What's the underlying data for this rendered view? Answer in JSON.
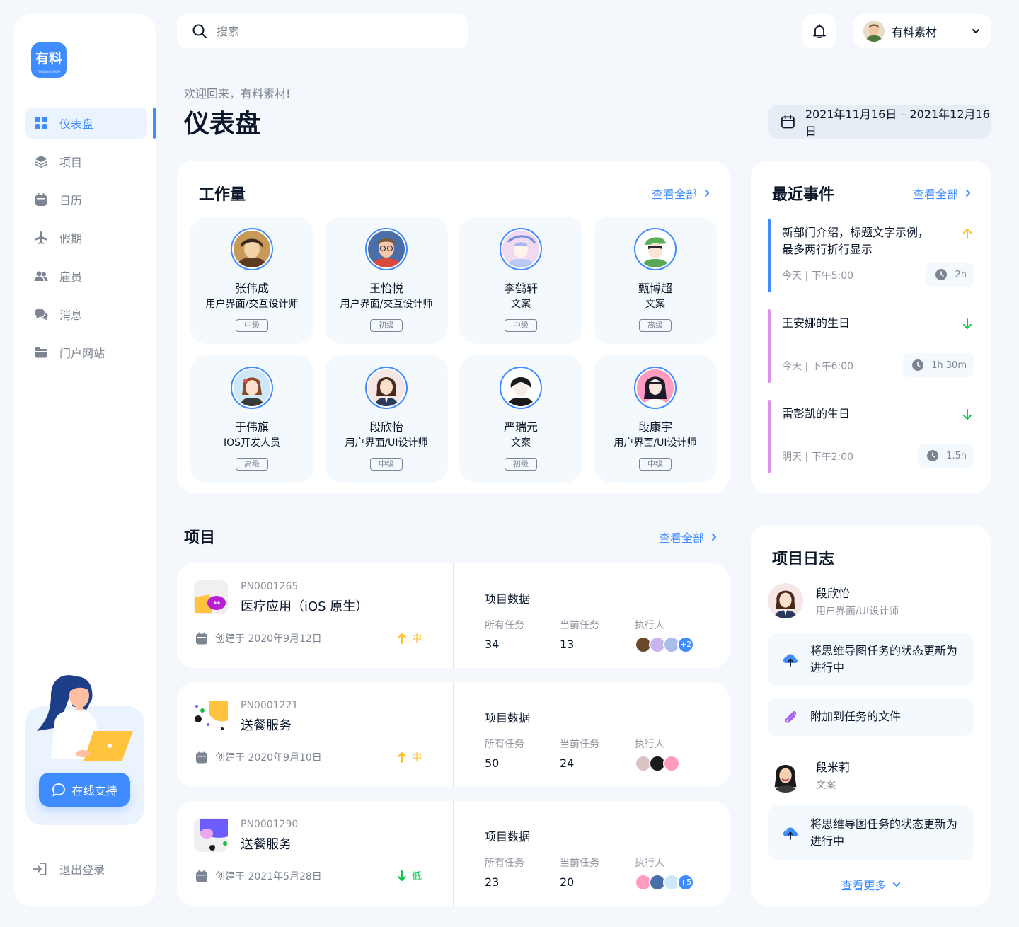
{
  "brand": {
    "logo_text": "有料",
    "logo_sub": "YOULIAOSUCAI"
  },
  "nav": [
    {
      "label": "仪表盘",
      "icon": "dashboard-icon",
      "active": true
    },
    {
      "label": "项目",
      "icon": "layers-icon"
    },
    {
      "label": "日历",
      "icon": "calendar-icon"
    },
    {
      "label": "假期",
      "icon": "airplane-icon"
    },
    {
      "label": "雇员",
      "icon": "users-icon"
    },
    {
      "label": "消息",
      "icon": "chat-icon"
    },
    {
      "label": "门户网站",
      "icon": "folder-icon"
    }
  ],
  "support": {
    "button_label": "在线支持"
  },
  "logout": {
    "label": "退出登录"
  },
  "search": {
    "placeholder": "搜索"
  },
  "user": {
    "name": "有料素材"
  },
  "header": {
    "welcome": "欢迎回来，有料素材!",
    "title": "仪表盘",
    "date_range": "2021年11月16日 – 2021年12月16日"
  },
  "workload": {
    "title": "工作量",
    "view_all": "查看全部",
    "members": [
      {
        "name": "张伟成",
        "role": "用户界面/交互设计师",
        "level": "中级"
      },
      {
        "name": "王怡悦",
        "role": "用户界面/交互设计师",
        "level": "初级"
      },
      {
        "name": "李鹤轩",
        "role": "文案",
        "level": "中级"
      },
      {
        "name": "甄博超",
        "role": "文案",
        "level": "高级"
      },
      {
        "name": "于伟旗",
        "role": "IOS开发人员",
        "level": "高级"
      },
      {
        "name": "段欣怡",
        "role": "用户界面/UI设计师",
        "level": "中级"
      },
      {
        "name": "严瑞元",
        "role": "文案",
        "level": "初级"
      },
      {
        "name": "段康宇",
        "role": "用户界面/UI设计师",
        "level": "中级"
      }
    ]
  },
  "events": {
    "title": "最近事件",
    "view_all": "查看全部",
    "items": [
      {
        "title": "新部门介绍，标题文字示例，最多两行折行显示",
        "time": "今天 | 下午5:00",
        "duration": "2h",
        "direction": "up",
        "color": "#3f8cff",
        "arrow_color": "#ffbd21"
      },
      {
        "title": "王安娜的生日",
        "time": "今天 | 下午6:00",
        "duration": "1h 30m",
        "direction": "down",
        "color": "#de92eb",
        "arrow_color": "#0ac947"
      },
      {
        "title": "雷彭凯的生日",
        "time": "明天 | 下午2:00",
        "duration": "1.5h",
        "direction": "down",
        "color": "#de92eb",
        "arrow_color": "#0ac947"
      }
    ]
  },
  "projects": {
    "title": "项目",
    "view_all": "查看全部",
    "data_label": "项目数据",
    "all_tasks_label": "所有任务",
    "current_tasks_label": "当前任务",
    "assignees_label": "执行人",
    "items": [
      {
        "pn": "PN0001265",
        "name": "医疗应用（iOS 原生）",
        "created": "创建于 2020年9月12日",
        "priority": "中",
        "priority_dir": "up",
        "priority_color": "#ffbd21",
        "all_tasks": "34",
        "current_tasks": "13",
        "extra": "+2"
      },
      {
        "pn": "PN0001221",
        "name": "送餐服务",
        "created": "创建于 2020年9月10日",
        "priority": "中",
        "priority_dir": "up",
        "priority_color": "#ffbd21",
        "all_tasks": "50",
        "current_tasks": "24",
        "extra": ""
      },
      {
        "pn": "PN0001290",
        "name": "送餐服务",
        "created": "创建于 2021年5月28日",
        "priority": "低",
        "priority_dir": "down",
        "priority_color": "#0ac947",
        "all_tasks": "23",
        "current_tasks": "20",
        "extra": "+5"
      }
    ]
  },
  "activity": {
    "title": "项目日志",
    "users": [
      {
        "name": "段欣怡",
        "role": "用户界面/UI设计师"
      },
      {
        "name": "段米莉",
        "role": "文案"
      }
    ],
    "items": [
      {
        "text": "将思维导图任务的状态更新为进行中",
        "icon": "cloud-upload-icon"
      },
      {
        "text": "附加到任务的文件",
        "icon": "paperclip-icon"
      },
      {
        "text": "将思维导图任务的状态更新为进行中",
        "icon": "cloud-upload-icon"
      }
    ],
    "view_more": "查看更多"
  }
}
